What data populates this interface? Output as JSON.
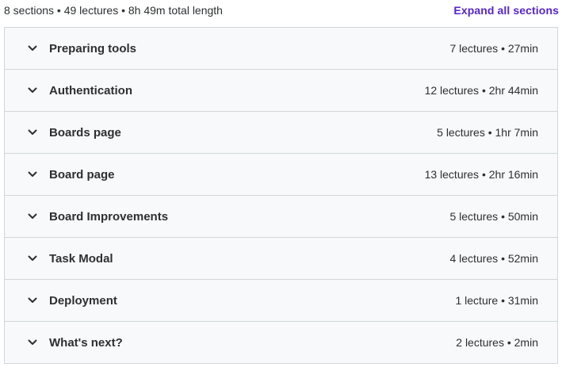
{
  "summary": {
    "text": "8 sections • 49 lectures • 8h 49m total length",
    "expand_all_label": "Expand all sections"
  },
  "colors": {
    "accent": "#5624d0",
    "row_bg": "#f7f9fa",
    "border": "#d1d7dc",
    "text": "#2d2f31"
  },
  "sections": [
    {
      "title": "Preparing tools",
      "meta": "7 lectures • 27min",
      "icon": "chevron-down-icon"
    },
    {
      "title": "Authentication",
      "meta": "12 lectures • 2hr 44min",
      "icon": "chevron-down-icon"
    },
    {
      "title": "Boards page",
      "meta": "5 lectures • 1hr 7min",
      "icon": "chevron-down-icon"
    },
    {
      "title": "Board page",
      "meta": "13 lectures • 2hr 16min",
      "icon": "chevron-down-icon"
    },
    {
      "title": "Board Improvements",
      "meta": "5 lectures • 50min",
      "icon": "chevron-down-icon"
    },
    {
      "title": "Task Modal",
      "meta": "4 lectures • 52min",
      "icon": "chevron-down-icon"
    },
    {
      "title": "Deployment",
      "meta": "1 lecture • 31min",
      "icon": "chevron-down-icon"
    },
    {
      "title": "What's next?",
      "meta": "2 lectures • 2min",
      "icon": "chevron-down-icon"
    }
  ]
}
